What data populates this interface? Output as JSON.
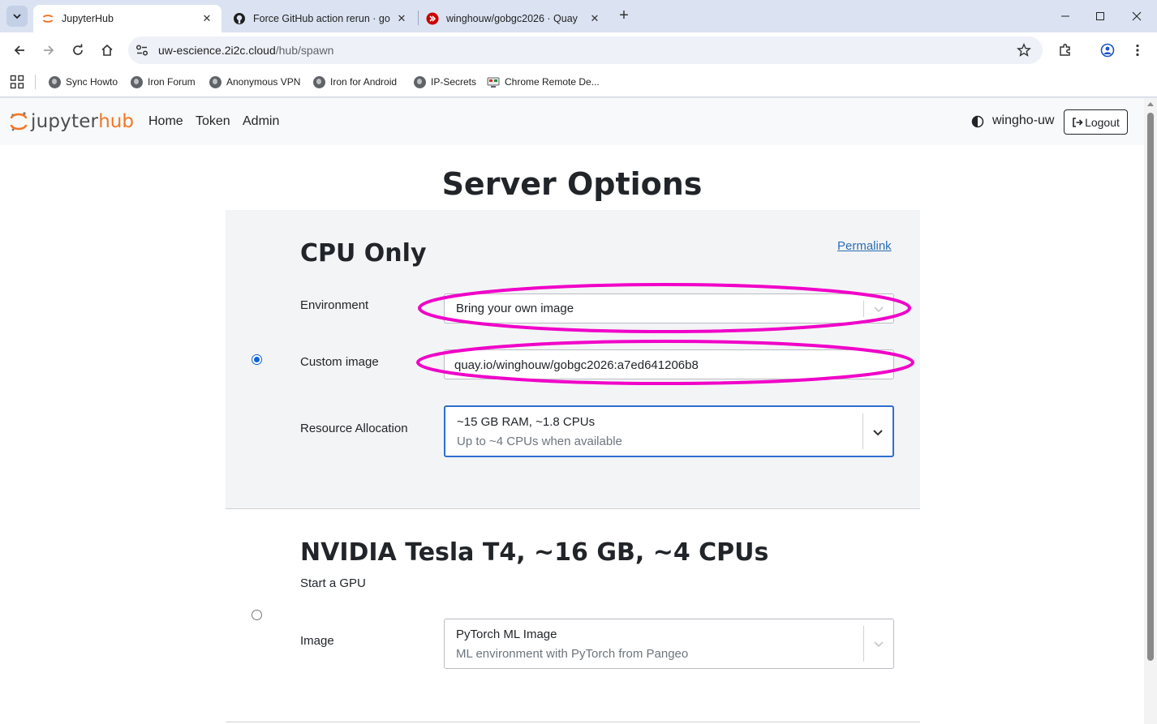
{
  "browser": {
    "tabs": [
      {
        "title": "JupyterHub",
        "active": true
      },
      {
        "title": "Force GitHub action rerun · go-",
        "active": false
      },
      {
        "title": "winghouw/gobgc2026 · Quay",
        "active": false
      }
    ],
    "url_host": "uw-escience.2i2c.cloud",
    "url_path": "/hub/spawn",
    "bookmarks": [
      "Sync Howto",
      "Iron Forum",
      "Anonymous VPN",
      "Iron for Android",
      "IP-Secrets",
      "Chrome Remote De..."
    ]
  },
  "navbar": {
    "brand_left": "jupyter",
    "brand_right": "hub",
    "links": [
      "Home",
      "Token",
      "Admin"
    ],
    "username": "wingho-uw",
    "logout_label": "Logout"
  },
  "page_title": "Server Options",
  "profiles": [
    {
      "title": "CPU Only",
      "selected": true,
      "permalink_label": "Permalink",
      "environment_label": "Environment",
      "environment_value": "Bring your own image",
      "custom_image_label": "Custom image",
      "custom_image_value": "quay.io/winghouw/gobgc2026:a7ed641206b8",
      "resource_label": "Resource Allocation",
      "resource_value": "~15 GB RAM, ~1.8 CPUs",
      "resource_sub": "Up to ~4 CPUs when available"
    },
    {
      "title": "NVIDIA Tesla T4, ~16 GB, ~4 CPUs",
      "selected": false,
      "description": "Start a GPU",
      "image_label": "Image",
      "image_value": "PyTorch ML Image",
      "image_sub": "ML environment with PyTorch from Pangeo"
    }
  ],
  "colors": {
    "brand_orange": "#f37726",
    "annotation_magenta": "#f000c8",
    "focus_blue": "#2f6fd0",
    "link_blue": "#2a6fb4"
  }
}
